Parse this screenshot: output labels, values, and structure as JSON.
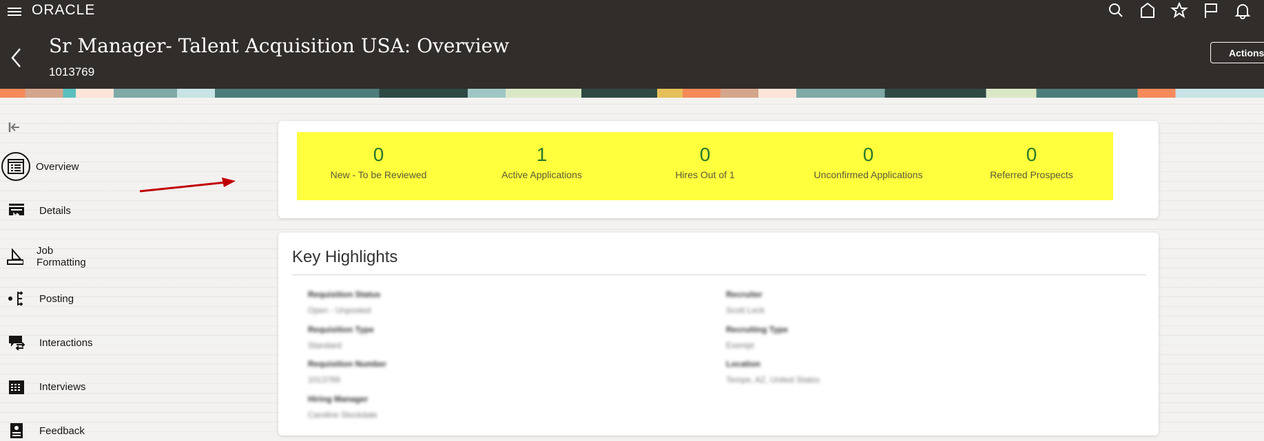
{
  "header": {
    "logo": "ORACLE",
    "title": "Sr Manager- Talent Acquisition USA: Overview",
    "requisition_id": "1013769",
    "actions_label": "Actions",
    "icons": [
      "search-icon",
      "home-icon",
      "favorites-star-icon",
      "flag-icon",
      "notifications-bell-icon"
    ]
  },
  "sidebar": {
    "items": [
      {
        "label": "Overview",
        "icon": "overview-list-icon",
        "active": true
      },
      {
        "label": "Details",
        "icon": "details-icon"
      },
      {
        "label": "Job Formatting",
        "icon": "ruler-triangle-icon"
      },
      {
        "label": "Posting",
        "icon": "posting-branch-icon"
      },
      {
        "label": "Interactions",
        "icon": "interactions-chat-icon"
      },
      {
        "label": "Interviews",
        "icon": "calendar-icon"
      },
      {
        "label": "Feedback",
        "icon": "feedback-badge-icon"
      }
    ]
  },
  "metrics": [
    {
      "value": "0",
      "label": "New - To be Reviewed"
    },
    {
      "value": "1",
      "label": "Active Applications"
    },
    {
      "value": "0",
      "label": "Hires Out of 1"
    },
    {
      "value": "0",
      "label": "Unconfirmed Applications"
    },
    {
      "value": "0",
      "label": "Referred Prospects"
    }
  ],
  "highlight_color": "#ffff3d",
  "key_highlights": {
    "title": "Key Highlights",
    "fields": [
      {
        "label": "Requisition Status",
        "value": "Open - Unposted"
      },
      {
        "label": "Requisition Type",
        "value": "Standard"
      },
      {
        "label": "Requisition Number",
        "value": "1013769"
      },
      {
        "label": "Hiring Manager",
        "value": "Caroline Stockdale"
      },
      {
        "label": "Recruiter",
        "value": "Scott Leck"
      },
      {
        "label": "Recruiting Type",
        "value": "Exempt"
      },
      {
        "label": "Location",
        "value": "Tempe, AZ, United States"
      }
    ]
  }
}
